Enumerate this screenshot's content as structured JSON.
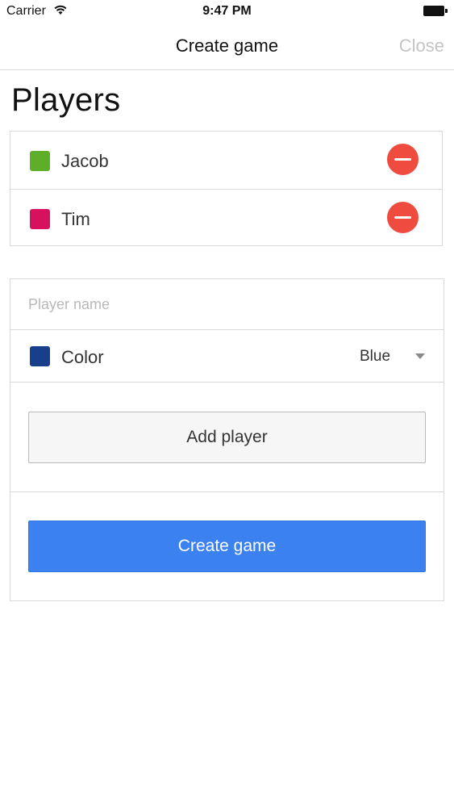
{
  "status_bar": {
    "carrier": "Carrier",
    "time": "9:47 PM",
    "icons": [
      "wifi-icon",
      "battery-icon"
    ]
  },
  "nav": {
    "title": "Create game",
    "close_label": "Close"
  },
  "players_section": {
    "title": "Players",
    "players": [
      {
        "name": "Jacob",
        "color": "#5fae2a",
        "remove_icon": "minus-circle-icon"
      },
      {
        "name": "Tim",
        "color": "#d8115f",
        "remove_icon": "minus-circle-icon"
      }
    ]
  },
  "form": {
    "name_placeholder": "Player name",
    "name_value": "",
    "color_label": "Color",
    "color_selected": "Blue",
    "color_swatch": "#173f8c",
    "add_button_label": "Add player",
    "create_button_label": "Create game"
  },
  "colors": {
    "accent": "#3b82f0",
    "danger": "#ef4b3f",
    "close_inactive": "#c4c4c4",
    "border": "#d9d9d9"
  }
}
